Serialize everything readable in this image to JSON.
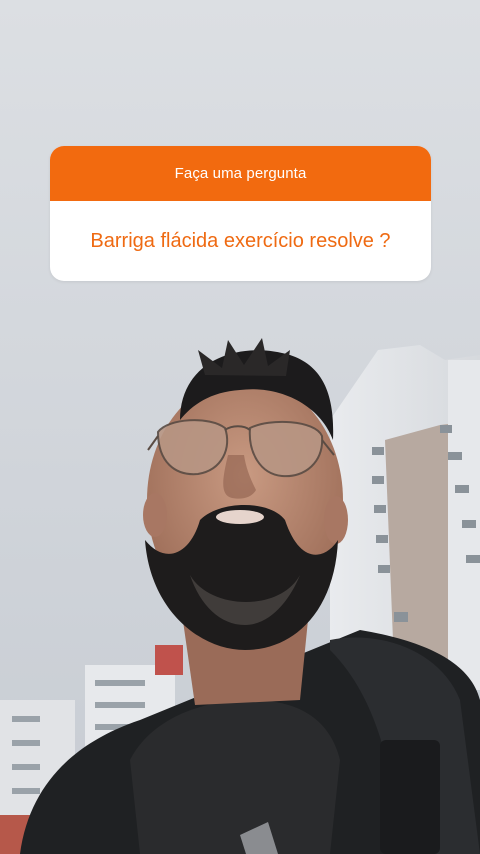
{
  "question_sticker": {
    "header": "Faça uma pergunta",
    "question": "Barriga flácida exercício resolve ?"
  },
  "colors": {
    "sticker_accent": "#f26a0f",
    "sticker_text": "#ef6a12",
    "sky": "#d3d7dc"
  }
}
